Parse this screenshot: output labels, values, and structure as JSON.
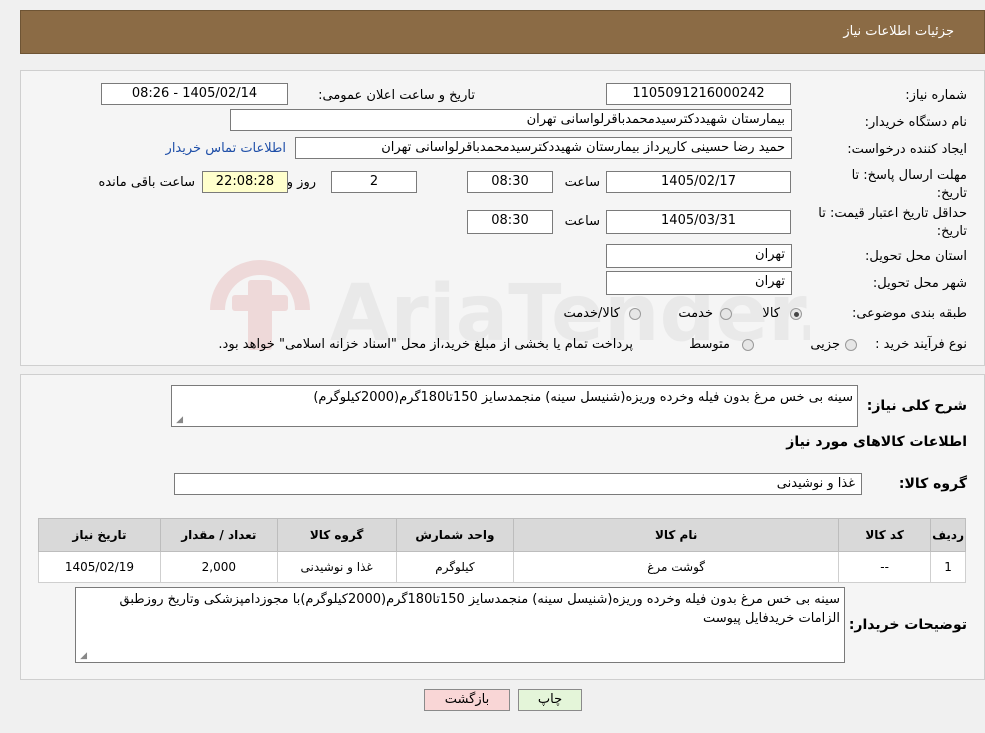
{
  "header": {
    "title": "جزئیات اطلاعات نیاز"
  },
  "form": {
    "need_number_label": "شماره نیاز:",
    "need_number": "1105091216000242",
    "announce_label": "تاریخ و ساعت اعلان عمومی:",
    "announce_value": "1405/02/14 - 08:26",
    "buyer_org_label": "نام دستگاه خریدار:",
    "buyer_org": "بیمارستان شهیددکترسیدمحمدباقرلواسانی تهران",
    "creator_label": "ایجاد کننده درخواست:",
    "creator": "حمید رضا  حسینی کارپرداز بیمارستان شهیددکترسیدمحمدباقرلواسانی تهران",
    "contact_link": "اطلاعات تماس خریدار",
    "deadline_label": "مهلت ارسال پاسخ: تا تاریخ:",
    "deadline_date": "1405/02/17",
    "time_label": "ساعت",
    "deadline_time": "08:30",
    "days_value": "2",
    "days_label": "روز و",
    "remaining_value": "22:08:28",
    "remaining_label": "ساعت باقی مانده",
    "validity_label": "حداقل تاریخ اعتبار قیمت: تا تاریخ:",
    "validity_date": "1405/03/31",
    "validity_time": "08:30",
    "province_label": "استان محل تحویل:",
    "province": "تهران",
    "city_label": "شهر محل تحویل:",
    "city": "تهران",
    "category_label": "طبقه بندی موضوعی:",
    "category_options": [
      "کالا",
      "خدمت",
      "کالا/خدمت"
    ],
    "category_selected": "کالا",
    "process_label": "نوع فرآیند خرید :",
    "process_options": [
      "جزیی",
      "متوسط"
    ],
    "process_note": "پرداخت تمام یا بخشی از مبلغ خرید،از محل \"اسناد خزانه اسلامی\" خواهد بود."
  },
  "watermark": {
    "text": "AriaTender.neT"
  },
  "details": {
    "desc_label": "شرح کلی نیاز:",
    "desc_value": "سینه بی خس مرغ بدون فیله وخرده وریزه(شنیسل سینه) منجمدسایز 150تا180گرم(2000کیلوگرم)",
    "goods_info_title": "اطلاعات کالاهای مورد نیاز",
    "group_label": "گروه کالا:",
    "group_value": "غذا و نوشیدنی",
    "table": {
      "headers": [
        "ردیف",
        "کد کالا",
        "نام کالا",
        "واحد شمارش",
        "گروه کالا",
        "تعداد / مقدار",
        "تاریخ نیاز"
      ],
      "rows": [
        [
          "1",
          "--",
          "گوشت مرغ",
          "کیلوگرم",
          "غذا و نوشیدنی",
          "2,000",
          "1405/02/19"
        ]
      ]
    },
    "buyer_notes_label": "توضیحات خریدار:",
    "buyer_notes_value": "سینه بی خس مرغ بدون فیله وخرده وریزه(شنیسل سینه) منجمدسایز 150تا180گرم(2000کیلوگرم)با مجوزدامپزشکی وتاریخ روزطبق الزامات خریدفایل پیوست"
  },
  "buttons": {
    "print": "چاپ",
    "back": "بازگشت"
  },
  "colors": {
    "header_bg": "#8b6b45",
    "back_btn_bg": "#f9d6d6",
    "print_btn_bg": "#e4f5d9",
    "link": "#1f4fa8"
  }
}
